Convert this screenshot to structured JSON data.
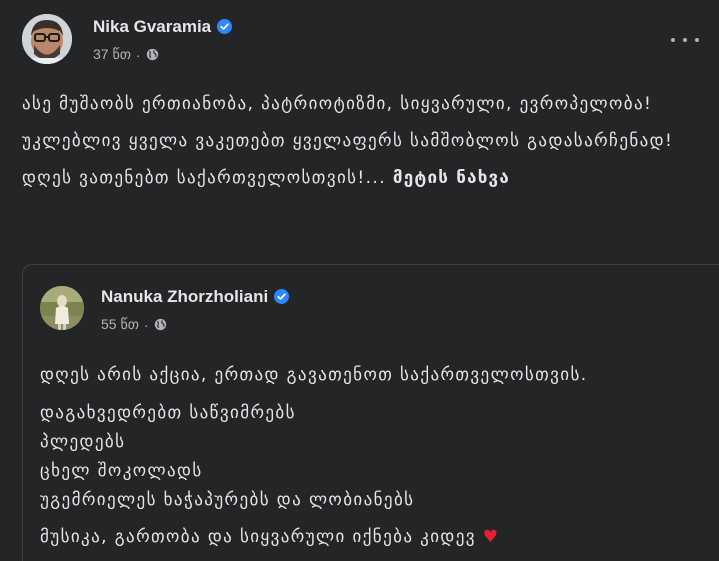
{
  "post": {
    "author": "Nika Gvaramia",
    "time": "37 წთ",
    "paragraphs": [
      "ასე მუშაობს ერთიანობა, პატრიოტიზმი, სიყვარული, ევროპელობა!",
      "უკლებლივ ყველა ვაკეთებთ ყველაფერს სამშობლოს გადასარჩენად!",
      "დღეს ვათენებთ საქართველოსთვის!..."
    ],
    "see_more": "მეტის ნახვა"
  },
  "shared": {
    "author": "Nanuka Zhorzholiani",
    "time": "55 წთ",
    "intro": "დღეს არის აქცია, ერთად გავათენოთ საქართველოსთვის.",
    "list": [
      "დაგახვედრებთ საწვიმრებს",
      "პლედებს",
      "ცხელ შოკოლადს",
      "უგემრიელეს ხაჭაპურებს და ლობიანებს"
    ],
    "closing": "მუსიკა, გართობა და სიყვარული იქნება კიდევ",
    "closing_emoji": "♥"
  },
  "colors": {
    "background": "#242526",
    "verified": "#2d88ff",
    "secondary_text": "#b0b3b8",
    "heart": "#e8202e"
  },
  "icons": [
    "verified-badge-icon",
    "globe-icon",
    "more-options-icon",
    "heart-emoji"
  ]
}
